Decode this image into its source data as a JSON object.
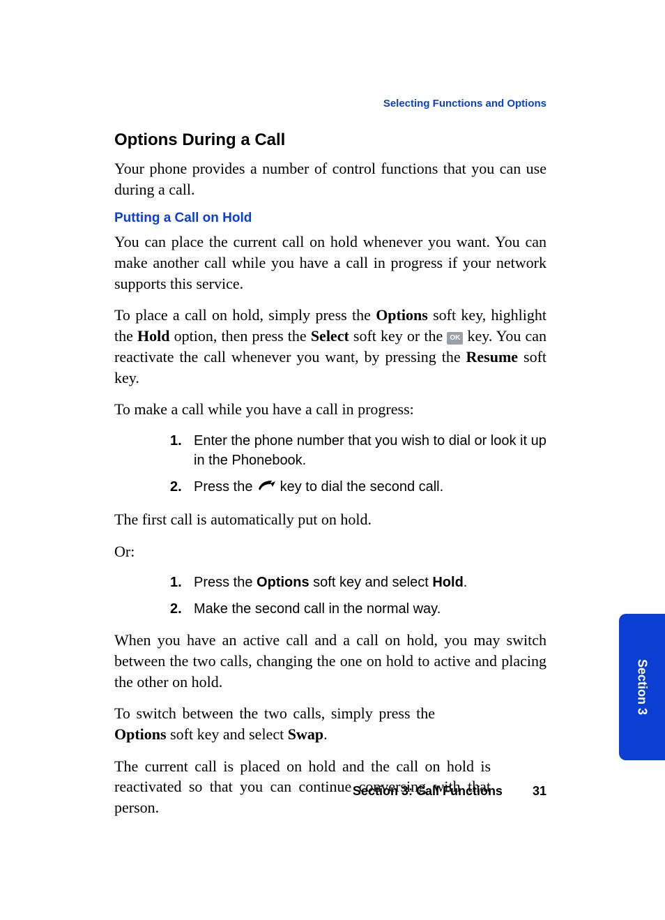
{
  "running_head": "Selecting Functions and Options",
  "title": "Options During a Call",
  "intro": "Your phone provides a number of control functions that you can use during a call.",
  "sub1_title": "Putting a Call on Hold",
  "sub1_p1": "You can place the current call on hold whenever you want. You can make another call while you have a call in progress if your network supports this service.",
  "sub1_p2a": "To place a call on hold, simply press the ",
  "sub1_p2_bold1": "Options",
  "sub1_p2b": " soft key, highlight the ",
  "sub1_p2_bold2": "Hold",
  "sub1_p2c": " option, then press the ",
  "sub1_p2_bold3": "Select",
  "sub1_p2d": " soft key or the ",
  "ok_label": "OK",
  "sub1_p2e": " key. You can reactivate the call whenever you want, by pressing the ",
  "sub1_p2_bold4": "Resume",
  "sub1_p2f": " soft key.",
  "sub1_p3": "To make a call while you have a call in progress:",
  "listA": [
    {
      "n": "1.",
      "text": "Enter the phone number that you wish to dial or look it up in the Phonebook."
    },
    {
      "n": "2.",
      "text_a": "Press the ",
      "icon": "dial",
      "text_b": " key to dial the second call."
    }
  ],
  "sub1_p4": "The first call is automatically put on hold.",
  "sub1_p5": "Or:",
  "listB": [
    {
      "n": "1.",
      "text_a": "Press the ",
      "bold1": "Options",
      "text_b": " soft key and select ",
      "bold2": "Hold",
      "text_c": "."
    },
    {
      "n": "2.",
      "text": "Make the second call in the normal way."
    }
  ],
  "sub1_p6": "When you have an active call and a call on hold, you may switch between the two calls, changing the one on hold to active and placing the other on hold.",
  "sub1_p7a": "To switch between the two calls, simply press the ",
  "sub1_p7_bold1": "Options",
  "sub1_p7b": " soft key and select ",
  "sub1_p7_bold2": "Swap",
  "sub1_p7c": ".",
  "sub1_p8": "The current call is placed on hold and the call on hold is reactivated so that you can continue conversing with that person.",
  "tab_label": "Section 3",
  "footer_section": "Section 3: Call Functions",
  "footer_page": "31"
}
